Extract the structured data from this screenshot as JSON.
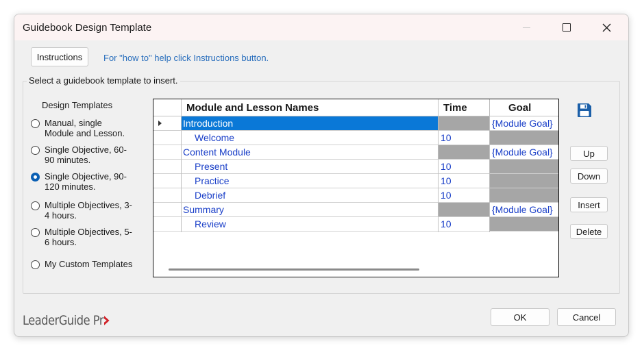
{
  "window": {
    "title": "Guidebook Design Template"
  },
  "instructions": {
    "button_label": "Instructions",
    "help_text": "For \"how to\" help click Instructions button."
  },
  "group": {
    "legend": "Select a guidebook template to insert."
  },
  "design_templates": {
    "label": "Design Templates",
    "options": [
      {
        "label": "Manual, single Module and Lesson.",
        "checked": false
      },
      {
        "label": "Single Objective, 60-90 minutes.",
        "checked": false
      },
      {
        "label": "Single Objective, 90-120 minutes.",
        "checked": true
      },
      {
        "label": "Multiple Objectives, 3-4 hours.",
        "checked": false
      },
      {
        "label": "Multiple Objectives, 5-6 hours.",
        "checked": false
      },
      {
        "label": "My Custom Templates",
        "checked": false
      }
    ]
  },
  "grid": {
    "headers": {
      "name": "Module and Lesson Names",
      "time": "Time",
      "goal": "Goal"
    },
    "rows": [
      {
        "name": "Introduction",
        "time": "",
        "goal": "{Module Goal}",
        "module": true,
        "selected": true
      },
      {
        "name": "Welcome",
        "time": "10",
        "goal": "",
        "module": false,
        "selected": false
      },
      {
        "name": "Content Module",
        "time": "",
        "goal": "{Module Goal}",
        "module": true,
        "selected": false
      },
      {
        "name": "Present",
        "time": "10",
        "goal": "",
        "module": false,
        "selected": false
      },
      {
        "name": "Practice",
        "time": "10",
        "goal": "",
        "module": false,
        "selected": false
      },
      {
        "name": "Debrief",
        "time": "10",
        "goal": "",
        "module": false,
        "selected": false
      },
      {
        "name": "Summary",
        "time": "",
        "goal": "{Module Goal}",
        "module": true,
        "selected": false
      },
      {
        "name": "Review",
        "time": "10",
        "goal": "",
        "module": false,
        "selected": false
      }
    ]
  },
  "side_buttons": {
    "up": "Up",
    "down": "Down",
    "insert": "Insert",
    "delete": "Delete"
  },
  "footer": {
    "logo_text": "LeaderGuide Pr",
    "ok": "OK",
    "cancel": "Cancel"
  },
  "colors": {
    "accent": "#0a78d7",
    "link": "#2a6fbd",
    "grid_text": "#1a3fc8",
    "logo_red": "#d2232a"
  }
}
